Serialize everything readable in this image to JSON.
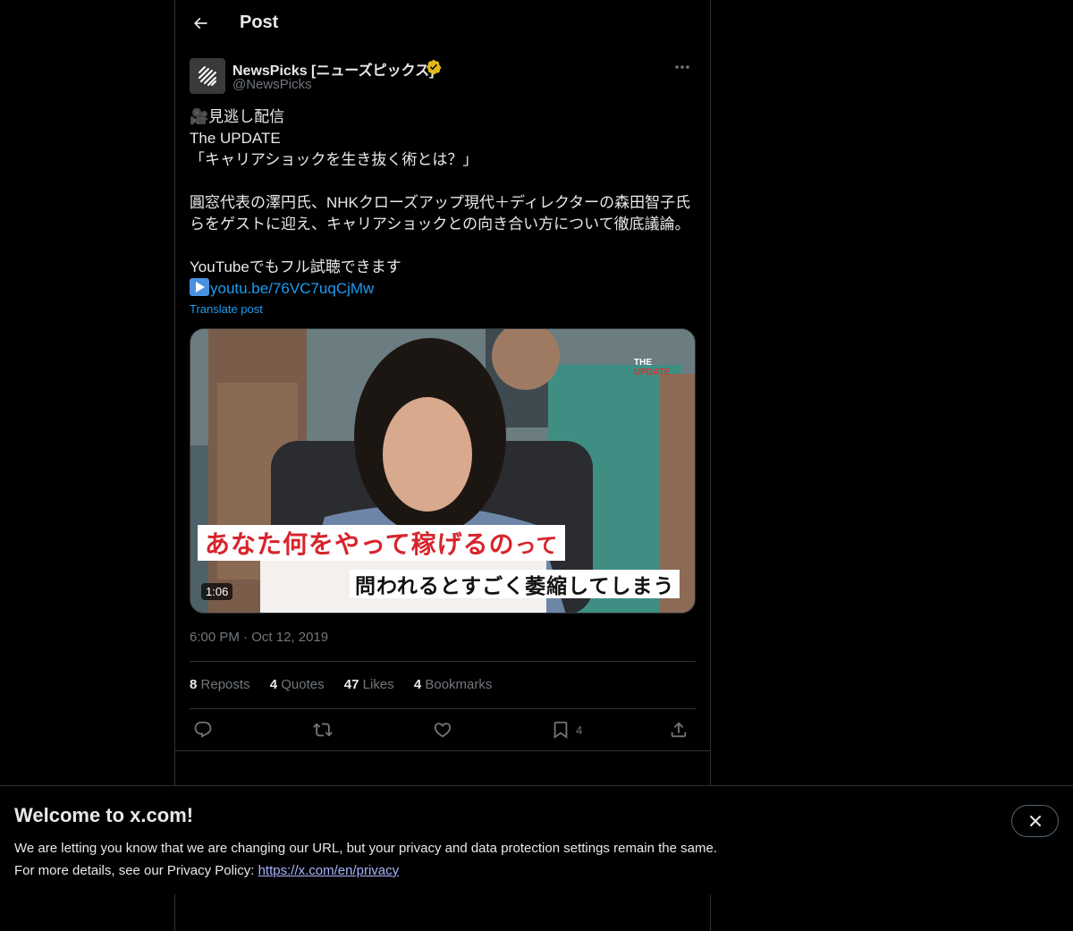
{
  "header": {
    "title": "Post"
  },
  "post": {
    "author": {
      "name": "NewsPicks [ニューズピックス]",
      "handle": "@NewsPicks",
      "verified_color": "#e2b719"
    },
    "text_lines": [
      "🎥見逃し配信",
      "The UPDATE",
      "「キャリアショックを生き抜く術とは？」",
      "",
      "圓窓代表の澤円氏、NHKクローズアップ現代＋ディレクターの森田智子氏",
      "らをゲストに迎え、キャリアショックとの向き合い方について徹底議論。",
      "",
      "YouTubeでもフル試聴できます"
    ],
    "link": "youtu.be/76VC7uqCjMw",
    "translate_label": "Translate post",
    "media": {
      "caption_red": "あなた何をやって稼げるの",
      "caption_red_tail": "って",
      "caption_black": "問われるとすごく萎縮してしまう",
      "duration": "1:06",
      "logo_line1": "THE",
      "logo_line2": "UPDATE"
    },
    "time": "6:00 PM",
    "date": "Oct 12, 2019",
    "stats": {
      "reposts": "8",
      "reposts_label": "Reposts",
      "quotes": "4",
      "quotes_label": "Quotes",
      "likes": "47",
      "likes_label": "Likes",
      "bookmarks": "4",
      "bookmarks_label": "Bookmarks"
    },
    "actions": {
      "bookmark_count": "4"
    }
  },
  "banner": {
    "title": "Welcome to x.com!",
    "line1": "We are letting you know that we are changing our URL, but your privacy and data protection settings remain the same.",
    "line2_prefix": "For more details, see our Privacy Policy: ",
    "link": "https://x.com/en/privacy"
  },
  "colors": {
    "accent": "#1d9bf0",
    "text": "#e7e9ea",
    "muted": "#71767b",
    "background": "#000000"
  }
}
